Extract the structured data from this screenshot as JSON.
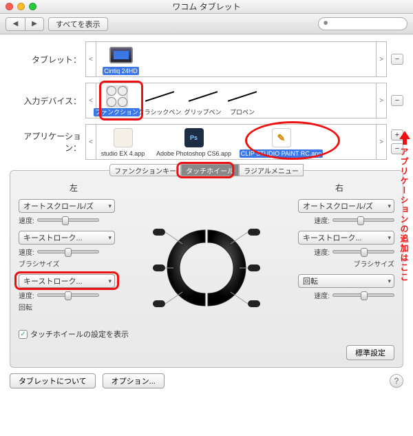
{
  "window": {
    "title": "ワコム タブレット"
  },
  "toolbar": {
    "show_all": "すべてを表示"
  },
  "sections": {
    "tablet": {
      "label": "タブレット：",
      "items": [
        {
          "name": "Cintiq 24HD"
        }
      ]
    },
    "device": {
      "label": "入力デバイス：",
      "items": [
        {
          "name": "ファンクション"
        },
        {
          "name": "クラシックペン"
        },
        {
          "name": "グリップペン"
        },
        {
          "name": "プロペン"
        }
      ]
    },
    "app": {
      "label": "アプリケーション：",
      "items": [
        {
          "name": "studio EX 4.app"
        },
        {
          "name": "Adobe Photoshop CS6.app"
        },
        {
          "name": "CLIP STUDIO PAINT RC.app"
        }
      ]
    }
  },
  "tabs": {
    "t1": "ファンクションキー",
    "t2": "タッチホイール",
    "t3": "ラジアルメニュー"
  },
  "panel": {
    "left_title": "左",
    "right_title": "右",
    "left": [
      {
        "dropdown": "オートスクロール/ズ",
        "speed_label": "速度:",
        "knob": 40
      },
      {
        "dropdown": "キーストローク...",
        "speed_label": "速度:",
        "sub": "ブラシサイズ",
        "knob": 45
      },
      {
        "dropdown": "キーストローク...",
        "speed_label": "速度:",
        "sub": "回転",
        "knob": 45
      }
    ],
    "right": [
      {
        "dropdown": "オートスクロール/ズ",
        "speed_label": "速度:",
        "knob": 40
      },
      {
        "dropdown": "キーストローク...",
        "speed_label": "速度:",
        "sub": "ブラシサイズ",
        "knob": 45
      },
      {
        "dropdown": "回転",
        "speed_label": "速度:",
        "knob": 45
      }
    ],
    "checkbox": "タッチホイールの設定を表示",
    "default_btn": "標準設定"
  },
  "annotation": "アプリケーションの追加はここ",
  "bottom": {
    "about": "タブレットについて",
    "options": "オプション..."
  }
}
